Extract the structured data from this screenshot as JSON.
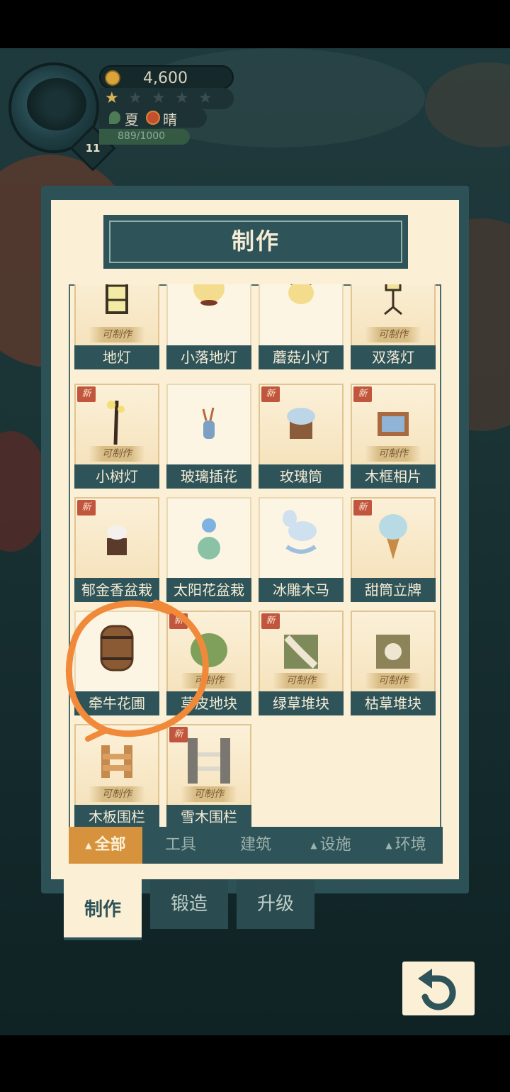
{
  "hud": {
    "coins": "4,600",
    "level": "11",
    "stars_total": 5,
    "stars_filled": 1,
    "season": "夏",
    "weather": "晴",
    "exp": "889/1000"
  },
  "panel": {
    "title": "制作",
    "craftable_label": "可制作",
    "new_label": "新",
    "items": [
      {
        "label": "地灯",
        "icon": "floor-lamp-icon",
        "craftable": true,
        "new": false
      },
      {
        "label": "小落地灯",
        "icon": "small-floor-lamp-icon",
        "craftable": false,
        "new": false
      },
      {
        "label": "蘑菇小灯",
        "icon": "mushroom-lamp-icon",
        "craftable": false,
        "new": false
      },
      {
        "label": "双落灯",
        "icon": "double-lamp-icon",
        "craftable": true,
        "new": false
      },
      {
        "label": "小树灯",
        "icon": "tree-lamp-icon",
        "craftable": true,
        "new": true
      },
      {
        "label": "玻璃插花",
        "icon": "glass-vase-icon",
        "craftable": false,
        "new": false
      },
      {
        "label": "玫瑰筒",
        "icon": "rose-tub-icon",
        "craftable": false,
        "new": true
      },
      {
        "label": "木框相片",
        "icon": "framed-photo-icon",
        "craftable": true,
        "new": true
      },
      {
        "label": "郁金香盆栽",
        "icon": "tulip-pot-icon",
        "craftable": false,
        "new": true
      },
      {
        "label": "太阳花盆栽",
        "icon": "sunflower-pot-icon",
        "craftable": false,
        "new": false
      },
      {
        "label": "冰雕木马",
        "icon": "ice-horse-icon",
        "craftable": false,
        "new": false
      },
      {
        "label": "甜筒立牌",
        "icon": "ice-cream-sign-icon",
        "craftable": false,
        "new": true
      },
      {
        "label": "牵牛花圃",
        "icon": "barrel-icon",
        "craftable": false,
        "new": false
      },
      {
        "label": "草皮地块",
        "icon": "turf-tile-icon",
        "craftable": true,
        "new": true
      },
      {
        "label": "绿草堆块",
        "icon": "green-grass-block-icon",
        "craftable": true,
        "new": true
      },
      {
        "label": "枯草堆块",
        "icon": "dry-grass-block-icon",
        "craftable": true,
        "new": false
      },
      {
        "label": "木板围栏",
        "icon": "wood-fence-icon",
        "craftable": true,
        "new": false
      },
      {
        "label": "雪木围栏",
        "icon": "snow-fence-icon",
        "craftable": true,
        "new": true
      }
    ]
  },
  "categories": [
    {
      "label": "全部",
      "arrow": true,
      "active": true
    },
    {
      "label": "工具",
      "arrow": false,
      "active": false
    },
    {
      "label": "建筑",
      "arrow": false,
      "active": false
    },
    {
      "label": "设施",
      "arrow": true,
      "active": false
    },
    {
      "label": "环境",
      "arrow": true,
      "active": false
    }
  ],
  "modes": [
    {
      "label": "制作",
      "active": true
    },
    {
      "label": "锻造",
      "active": false
    },
    {
      "label": "升级",
      "active": false
    }
  ],
  "colors": {
    "panel_bg": "#fbf0d6",
    "panel_border": "#2c5257",
    "accent_tab": "#d7923d",
    "new_badge": "#c1553e",
    "highlight_stroke": "#f08a3a"
  }
}
